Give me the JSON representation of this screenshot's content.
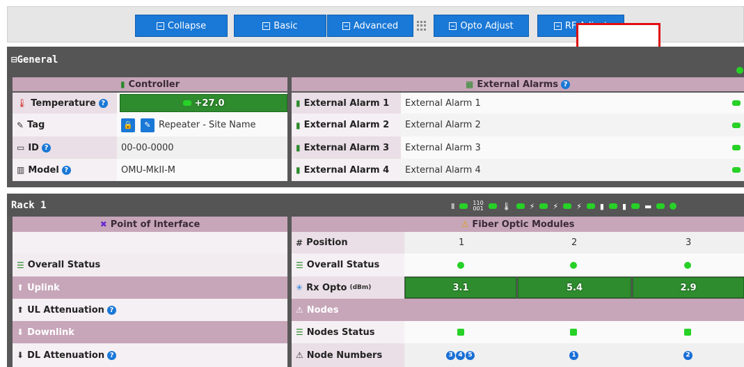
{
  "toolbar": {
    "collapse_label": "Collapse",
    "basic_label": "Basic",
    "advanced_label": "Advanced",
    "opto_adjust_label": "Opto Adjust",
    "rf_adjust_label": "RF Adjust"
  },
  "general": {
    "title": "General",
    "controller_header": "Controller",
    "external_alarms_header": "External Alarms",
    "rows": [
      {
        "label": "Temperature",
        "value": "+27.0"
      },
      {
        "label": "Tag",
        "value": "Repeater - Site Name"
      },
      {
        "label": "ID",
        "value": "00-00-0000"
      },
      {
        "label": "Model",
        "value": "OMU-MkII-M"
      }
    ],
    "alarms": [
      {
        "label": "External Alarm 1",
        "value": "External Alarm 1",
        "num": "1"
      },
      {
        "label": "External Alarm 2",
        "value": "External Alarm 2",
        "num": "2"
      },
      {
        "label": "External Alarm 3",
        "value": "External Alarm 3",
        "num": "3"
      },
      {
        "label": "External Alarm 4",
        "value": "External Alarm 4",
        "num": "4"
      }
    ]
  },
  "rack": {
    "title": "Rack 1",
    "status_icons_text": "110\n001",
    "poi_header": "Point of Interface",
    "fom_header": "Fiber Optic Modules",
    "poi_rows": [
      "",
      "Overall Status",
      "Uplink",
      "UL Attenuation",
      "Downlink",
      "DL Attenuation"
    ],
    "fom_rows": {
      "position_label": "Position",
      "positions": [
        "1",
        "2",
        "3"
      ],
      "overall_status_label": "Overall Status",
      "rx_opto_label": "Rx Opto",
      "rx_opto_unit": "(dBm)",
      "rx_opto_values": [
        "3.1",
        "5.4",
        "2.9"
      ],
      "nodes_label": "Nodes",
      "nodes_status_label": "Nodes Status",
      "node_numbers_label": "Node Numbers",
      "node_numbers": [
        [
          "3",
          "4",
          "5"
        ],
        [
          "1"
        ],
        [
          "2"
        ]
      ]
    }
  },
  "colors": {
    "button_blue": "#1a78d6",
    "section_gray": "#555555",
    "mauve": "#c7a6b9",
    "status_green": "#27d127",
    "bar_green": "#2e8b2e",
    "highlight_red": "#e01010"
  }
}
